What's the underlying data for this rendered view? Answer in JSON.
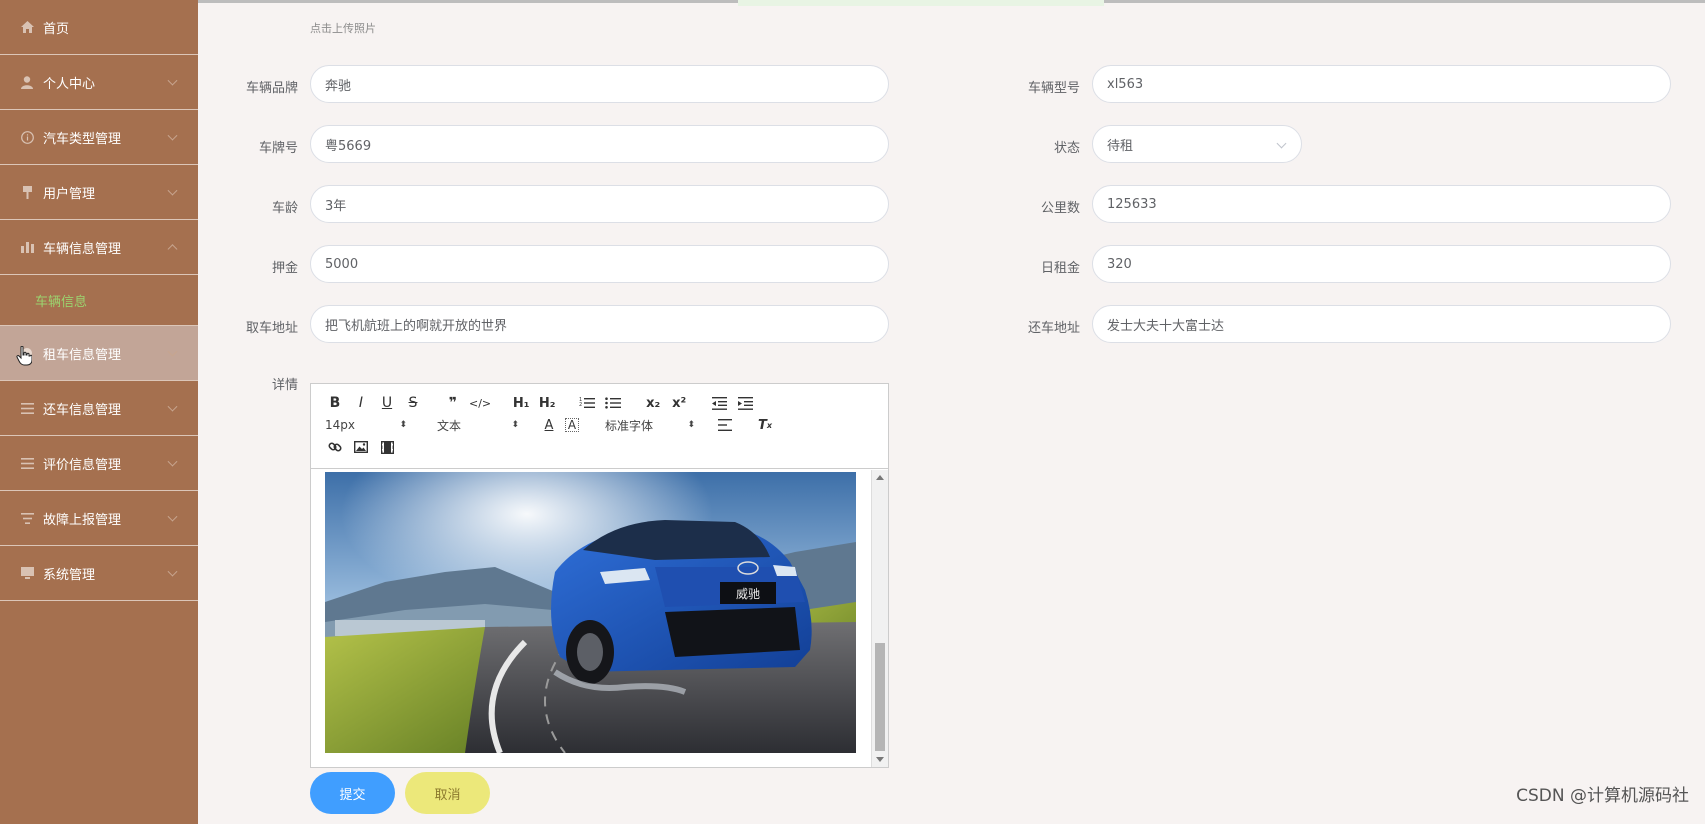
{
  "sidebar": {
    "items": [
      {
        "label": "首页",
        "icon": "home-icon"
      },
      {
        "label": "个人中心",
        "icon": "user-icon"
      },
      {
        "label": "汽车类型管理",
        "icon": "info-icon"
      },
      {
        "label": "用户管理",
        "icon": "pin-icon"
      },
      {
        "label": "车辆信息管理",
        "icon": "bar-chart-icon"
      },
      {
        "label": "租车信息管理",
        "icon": "pointer-icon"
      },
      {
        "label": "还车信息管理",
        "icon": "list-icon"
      },
      {
        "label": "评价信息管理",
        "icon": "list-icon"
      },
      {
        "label": "故障上报管理",
        "icon": "filter-icon"
      },
      {
        "label": "系统管理",
        "icon": "monitor-icon"
      }
    ],
    "sub_item": "车辆信息"
  },
  "form": {
    "upload_hint": "点击上传照片",
    "brand_label": "车辆品牌",
    "brand_value": "奔驰",
    "model_label": "车辆型号",
    "model_value": "xl563",
    "plate_label": "车牌号",
    "plate_value": "粤5669",
    "status_label": "状态",
    "status_value": "待租",
    "age_label": "车龄",
    "age_value": "3年",
    "mileage_label": "公里数",
    "mileage_value": "125633",
    "deposit_label": "押金",
    "deposit_value": "5000",
    "daily_rent_label": "日租金",
    "daily_rent_value": "320",
    "pickup_label": "取车地址",
    "pickup_value": "把飞机航班上的啊就开放的世界",
    "return_label": "还车地址",
    "return_value": "发士大夫十大富士达",
    "detail_label": "详情"
  },
  "editor": {
    "font_size": "14px",
    "block_format": "文本",
    "font_family": "标准字体",
    "image_caption": "威驰"
  },
  "buttons": {
    "submit": "提交",
    "cancel": "取消"
  },
  "watermark": "CSDN @计算机源码社",
  "colors": {
    "sidebar_bg": "#a5704f",
    "active_item_bg": "#c2a597",
    "sub_item_text": "#9bd46f",
    "submit_bg": "#409eff",
    "cancel_bg": "#ece87a"
  }
}
